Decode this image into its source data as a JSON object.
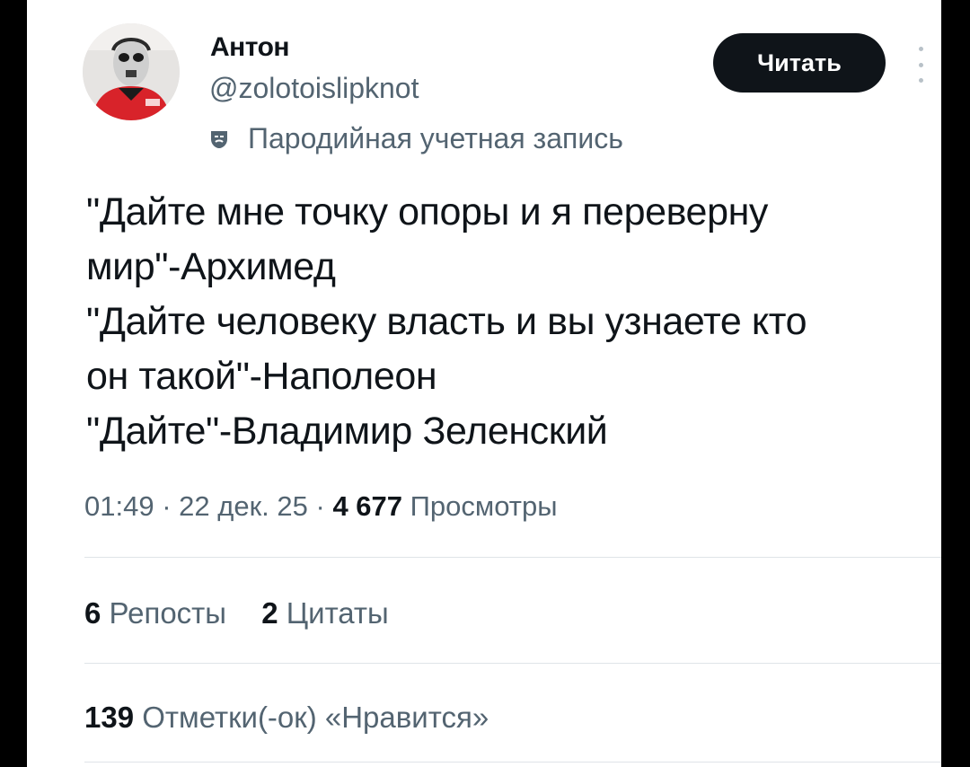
{
  "user": {
    "name": "Антон",
    "handle": "@zolotoislipknot",
    "parody_label": "Пародийная учетная запись"
  },
  "follow_button_label": "Читать",
  "tweet": {
    "lines": [
      "\"Дайте мне точку опоры и я переверну",
      "мир\"-Архимед",
      "\"Дайте человеку власть и вы узнаете кто",
      "он такой\"-Наполеон",
      "\"Дайте\"-Владимир Зеленский"
    ]
  },
  "meta": {
    "time": "01:49",
    "separator": "·",
    "date": "22 дек. 25",
    "views_count": "4 677",
    "views_label": "Просмотры"
  },
  "stats": {
    "reposts_count": "6",
    "reposts_label": "Репосты",
    "quotes_count": "2",
    "quotes_label": "Цитаты",
    "likes_count": "139",
    "likes_label": "Отметки(-ок) «Нравится»"
  },
  "colors": {
    "primary_text": "#0f1419",
    "secondary_text": "#536471",
    "button_bg": "#0f1419",
    "divider": "#dfe4e8"
  }
}
